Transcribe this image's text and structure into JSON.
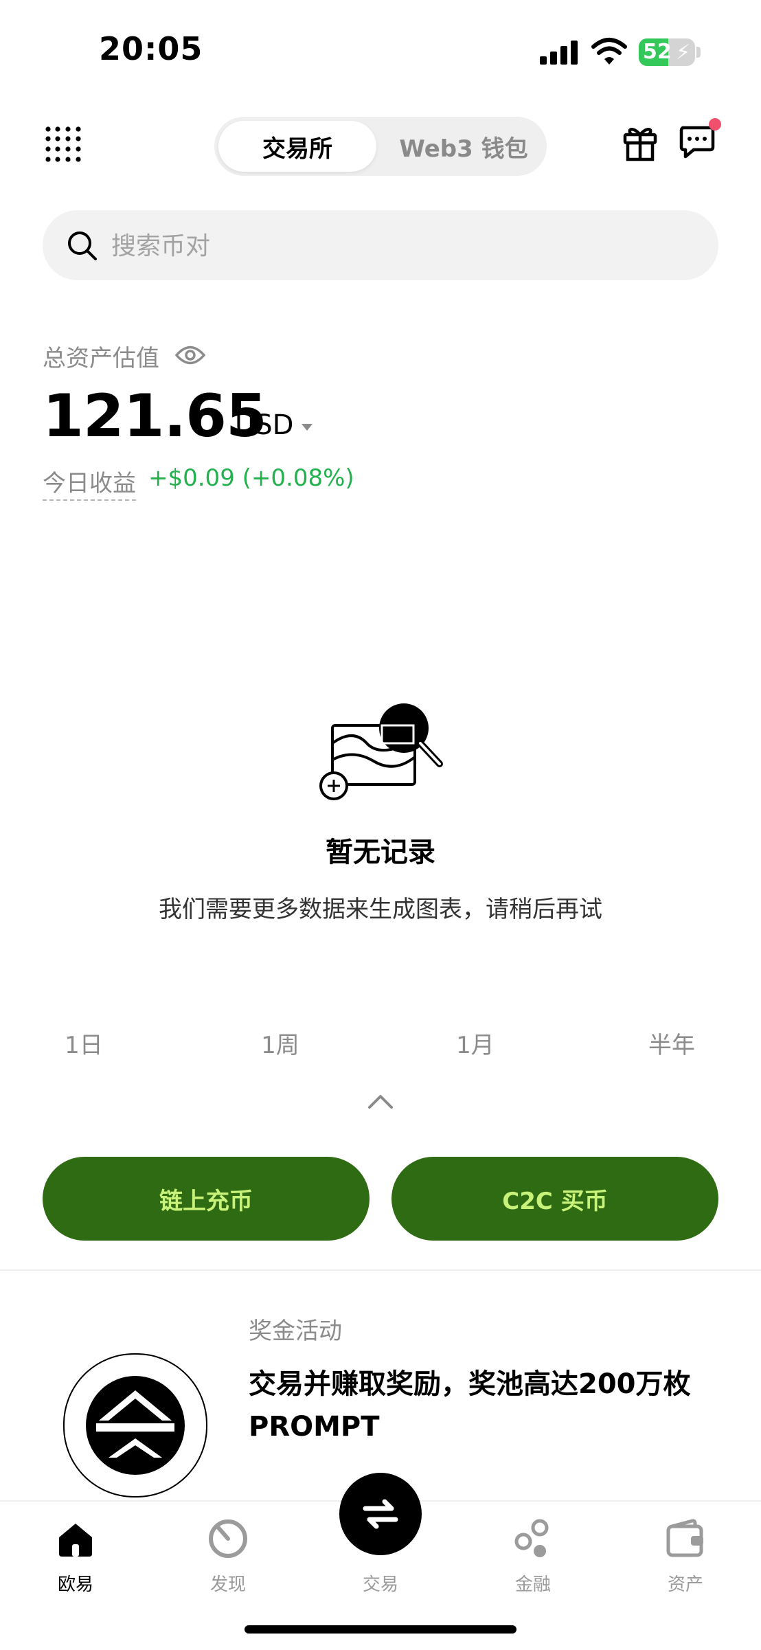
{
  "status_bar": {
    "time": "20:05",
    "battery": "52",
    "battery_level": 0.52
  },
  "header": {
    "tab_exchange": "交易所",
    "tab_web3": "Web3 钱包"
  },
  "search": {
    "placeholder": "搜索币对"
  },
  "assets": {
    "label": "总资产估值",
    "amount": "121.65",
    "currency": "USD",
    "today_label": "今日收益",
    "today_value": "+$0.09 (+0.08%)"
  },
  "empty_state": {
    "title": "暂无记录",
    "description": "我们需要更多数据来生成图表，请稍后再试"
  },
  "time_ranges": [
    "1日",
    "1周",
    "1月",
    "半年"
  ],
  "actions": {
    "deposit": "链上充币",
    "buy": "C2C 买币"
  },
  "promo": {
    "tag": "奖金活动",
    "title": "交易并赚取奖励，奖池高达200万枚 PROMPT"
  },
  "tabbar": {
    "items": [
      "欧易",
      "发现",
      "交易",
      "金融",
      "资产"
    ],
    "active_index": 0
  },
  "colors": {
    "accent_green": "#2e6b12",
    "button_text": "#c9f27a",
    "profit_green": "#23b14d",
    "badge_red": "#f0506e"
  }
}
